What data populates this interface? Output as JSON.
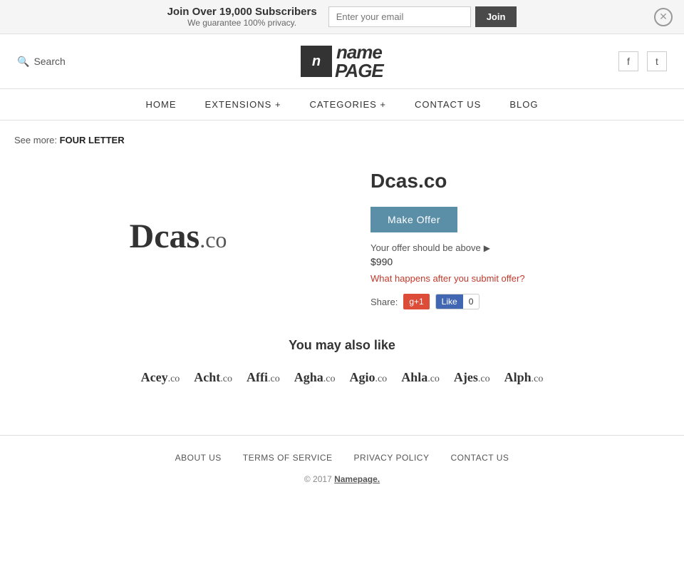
{
  "banner": {
    "title": "Join Over 19,000 Subscribers",
    "subtitle": "We guarantee 100% privacy.",
    "email_placeholder": "Enter your email",
    "join_label": "Join"
  },
  "header": {
    "search_label": "Search",
    "logo_icon": "n",
    "logo_name": "name",
    "logo_page": "PAGE",
    "facebook_icon": "f",
    "twitter_icon": "t"
  },
  "nav": {
    "items": [
      {
        "label": "HOME",
        "id": "home"
      },
      {
        "label": "EXTENSIONS +",
        "id": "extensions"
      },
      {
        "label": "CATEGORIES +",
        "id": "categories"
      },
      {
        "label": "CONTACT US",
        "id": "contact"
      },
      {
        "label": "BLOG",
        "id": "blog"
      }
    ]
  },
  "see_more": {
    "prefix": "See more:",
    "label": "FOUR LETTER"
  },
  "domain": {
    "name_display": "Dcas",
    "tld_display": ".co",
    "full_name": "Dcas.co",
    "make_offer_label": "Make Offer",
    "offer_hint": "Your offer should be above",
    "offer_price": "$990",
    "offer_info_link": "What happens after you submit offer?",
    "share_label": "Share:",
    "gplus_label": "g+1",
    "fb_like_label": "Like",
    "fb_count": "0"
  },
  "also_like": {
    "title": "You may also like",
    "items": [
      {
        "name": "Acey",
        "tld": ".co"
      },
      {
        "name": "Acht",
        "tld": ".co"
      },
      {
        "name": "Affi",
        "tld": ".co"
      },
      {
        "name": "Agha",
        "tld": ".co"
      },
      {
        "name": "Agio",
        "tld": ".co"
      },
      {
        "name": "Ahla",
        "tld": ".co"
      },
      {
        "name": "Ajes",
        "tld": ".co"
      },
      {
        "name": "Alph",
        "tld": ".co"
      }
    ]
  },
  "footer": {
    "links": [
      {
        "label": "ABOUT US",
        "id": "about"
      },
      {
        "label": "TERMS OF SERVICE",
        "id": "terms"
      },
      {
        "label": "PRIVACY POLICY",
        "id": "privacy"
      },
      {
        "label": "CONTACT US",
        "id": "contact"
      }
    ],
    "copy": "© 2017",
    "copy_link": "Namepage."
  }
}
